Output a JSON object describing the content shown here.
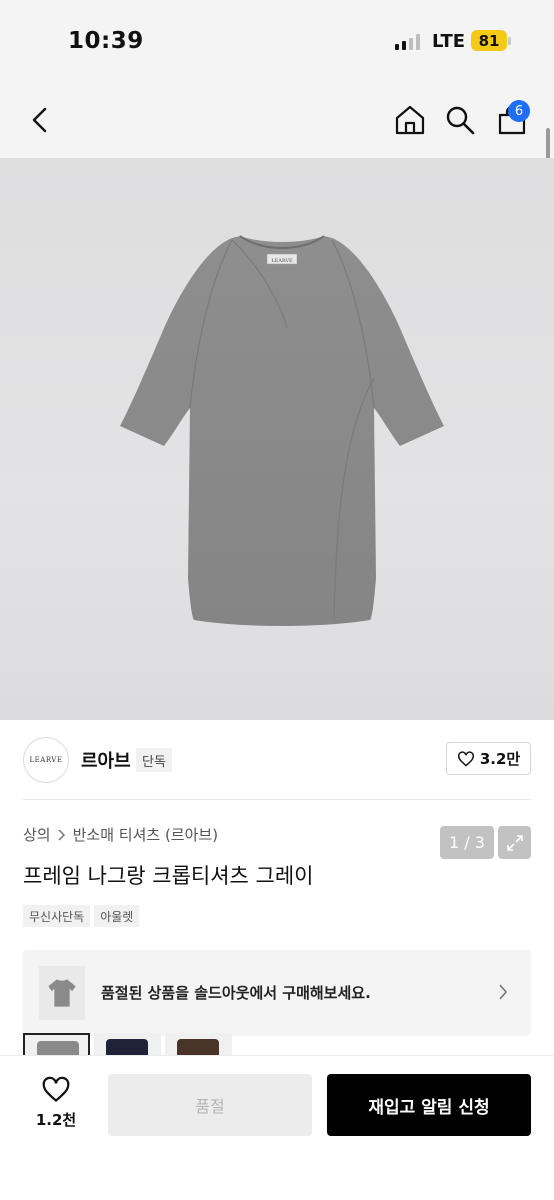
{
  "status_bar": {
    "time": "10:39",
    "network": "LTE",
    "battery": "81"
  },
  "header": {
    "cart_count": "6"
  },
  "gallery": {
    "counter": "1 / 3",
    "logo_label": "LEARVE"
  },
  "brand": {
    "logo_text": "LEARVE",
    "name": "르아브",
    "tag": "단독",
    "likes": "3.2만"
  },
  "product": {
    "breadcrumb": [
      "상의",
      "반소매 티셔츠 (르아브)"
    ],
    "title": "프레임 나그랑 크롭티셔츠 그레이",
    "chips": [
      "무신사단독",
      "아울렛"
    ]
  },
  "soldout_banner": {
    "message": "품절된 상품을 솔드아웃에서 구매해보세요."
  },
  "swatches": [
    {
      "color": "#8a8a8a"
    },
    {
      "color": "#1f2238"
    },
    {
      "color": "#4a3429"
    }
  ],
  "bottom_bar": {
    "wish_count": "1.2천",
    "soldout_label": "품절",
    "notify_label": "재입고 알림 신청"
  }
}
